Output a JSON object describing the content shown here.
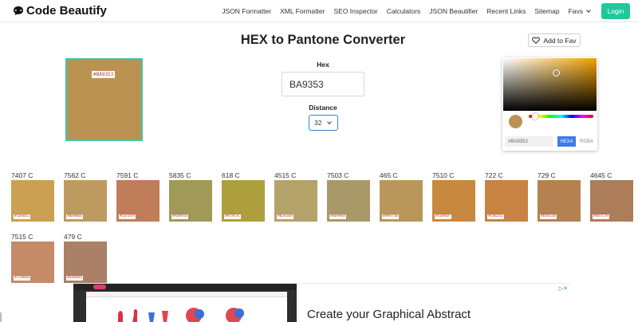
{
  "app": {
    "logo_text": "Code Beautify",
    "login_label": "Login",
    "nav": [
      {
        "label": "JSON Formatter"
      },
      {
        "label": "XML Formatter"
      },
      {
        "label": "SEO Inspector"
      },
      {
        "label": "Calculators"
      },
      {
        "label": "JSON Beautifier"
      },
      {
        "label": "Recent Links"
      },
      {
        "label": "Sitemap"
      },
      {
        "label": "Favs"
      }
    ]
  },
  "converter": {
    "title": "HEX to Pantone Converter",
    "fav_label": "Add to Fav",
    "preview_color": "#BA9353",
    "preview_label": "#BA9353",
    "hex_label": "Hex",
    "hex_value": "BA9353",
    "distance_label": "Distance",
    "distance_value": "32"
  },
  "picker": {
    "value": "#BA9353",
    "mode_hexa": "HEXA",
    "mode_rgba": "RGBA",
    "selected_mode": "HEXA"
  },
  "results": [
    {
      "name": "7407 C",
      "hex": "#CBA052"
    },
    {
      "name": "7562 C",
      "hex": "#BD9B60"
    },
    {
      "name": "7591 C",
      "hex": "#C07D59"
    },
    {
      "name": "5835 C",
      "hex": "#A09958"
    },
    {
      "name": "618 C",
      "hex": "#AC9F3C"
    },
    {
      "name": "4515 C",
      "hex": "#B3A369"
    },
    {
      "name": "7503 C",
      "hex": "#A89968"
    },
    {
      "name": "465 C",
      "hex": "#B9975B"
    },
    {
      "name": "7510 C",
      "hex": "#C6893F"
    },
    {
      "name": "722 C",
      "hex": "#C88242"
    },
    {
      "name": "729 C",
      "hex": "#B58150"
    },
    {
      "name": "4645 C",
      "hex": "#AD7C59"
    },
    {
      "name": "7515 C",
      "hex": "#C58B68"
    },
    {
      "name": "479 C",
      "hex": "#AA8066"
    }
  ],
  "ad": {
    "headline": "Create your Graphical Abstract"
  }
}
